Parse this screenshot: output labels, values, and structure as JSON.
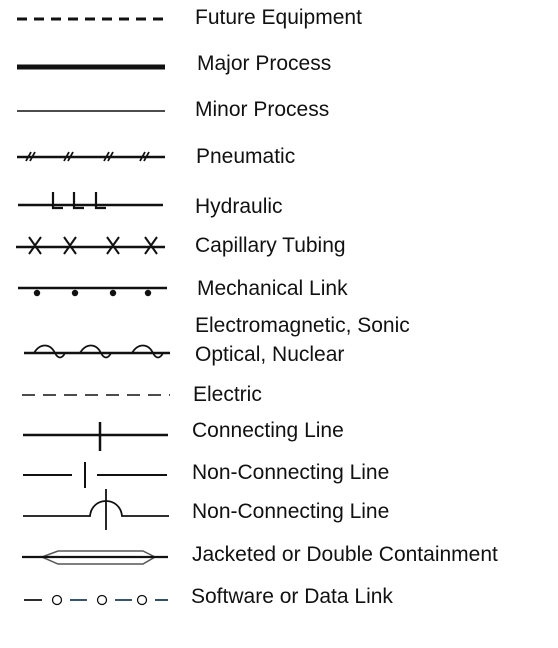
{
  "legend": {
    "items": [
      {
        "symbol": "dashed-heavy-line",
        "label": "Future Equipment"
      },
      {
        "symbol": "thick-line",
        "label": "Major Process"
      },
      {
        "symbol": "thin-line",
        "label": "Minor Process"
      },
      {
        "symbol": "double-hash-line",
        "label": "Pneumatic"
      },
      {
        "symbol": "l-mark-line",
        "label": "Hydraulic"
      },
      {
        "symbol": "x-mark-line",
        "label": "Capillary Tubing"
      },
      {
        "symbol": "dot-line",
        "label": "Mechanical Link"
      },
      {
        "symbol": "sine-line",
        "label": "Electromagnetic, Sonic",
        "label2": "Optical, Nuclear"
      },
      {
        "symbol": "dashed-thin-line",
        "label": "Electric"
      },
      {
        "symbol": "cross-line",
        "label": "Connecting Line"
      },
      {
        "symbol": "broken-cross-line",
        "label": "Non-Connecting Line"
      },
      {
        "symbol": "hop-line",
        "label": "Non-Connecting Line"
      },
      {
        "symbol": "jacketed-line",
        "label": "Jacketed or Double Containment"
      },
      {
        "symbol": "circle-dash-line",
        "label": "Software or Data Link"
      }
    ]
  }
}
